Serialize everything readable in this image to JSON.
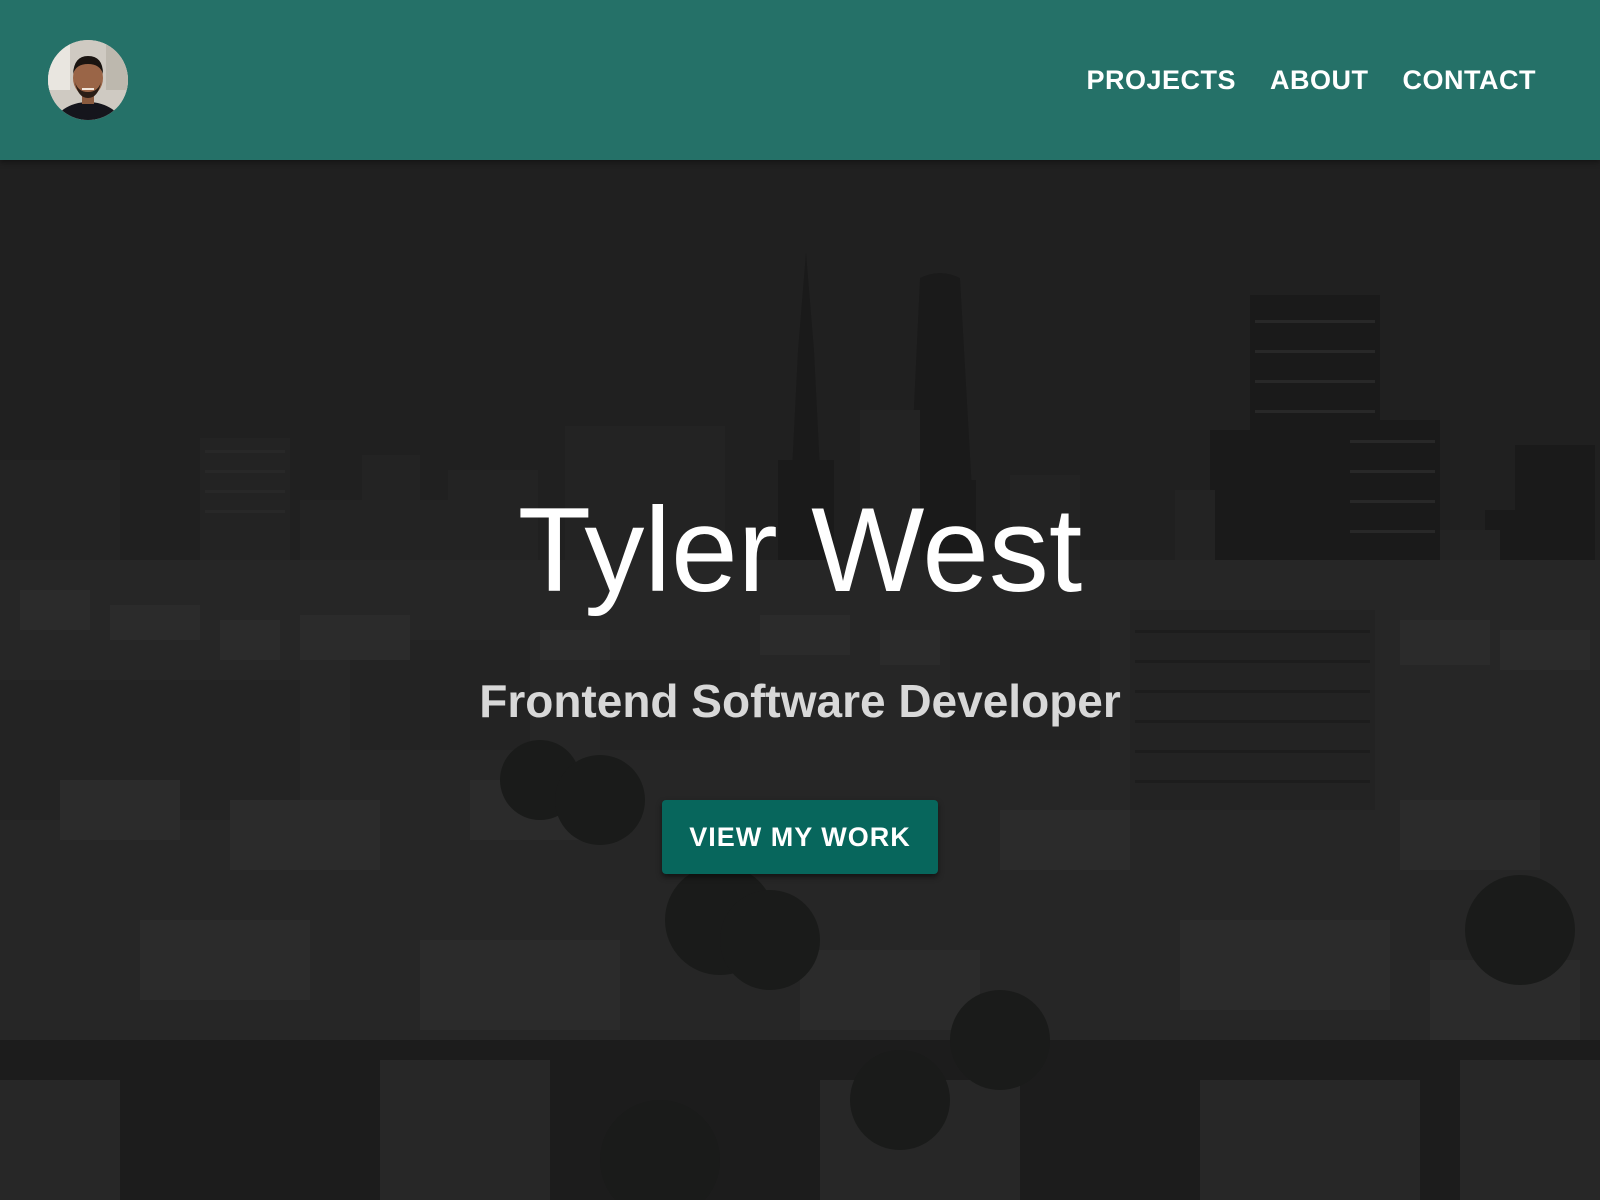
{
  "header": {
    "avatar_icon": "profile-photo",
    "nav": [
      {
        "label": "PROJECTS"
      },
      {
        "label": "ABOUT"
      },
      {
        "label": "CONTACT"
      }
    ]
  },
  "hero": {
    "title": "Tyler West",
    "subtitle": "Frontend Software Developer",
    "cta_label": "VIEW MY WORK",
    "background_icon": "city-skyline-photo"
  },
  "colors": {
    "header_bg": "#257168",
    "cta_bg": "#07665c",
    "hero_bg": "#222222",
    "text": "#ffffff"
  }
}
